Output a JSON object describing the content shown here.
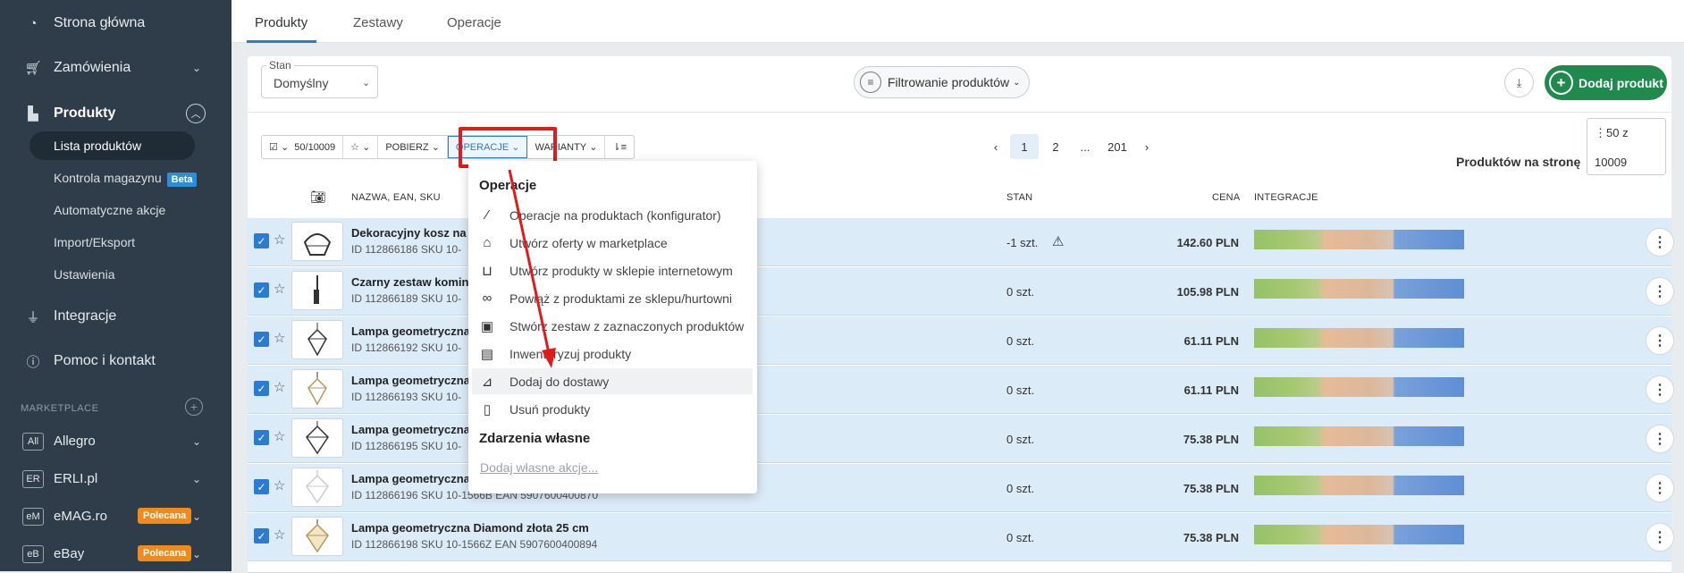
{
  "sidebar": {
    "items": [
      {
        "label": "Strona główna",
        "icon": "dashboard-icon"
      },
      {
        "label": "Zamówienia",
        "icon": "cart-icon"
      },
      {
        "label": "Produkty",
        "icon": "factory-icon"
      },
      {
        "label": "Integracje",
        "icon": "plug-icon"
      },
      {
        "label": "Pomoc i kontakt",
        "icon": "help-icon"
      }
    ],
    "sub_items": [
      "Lista produktów",
      "Kontrola magazynu",
      "Automatyczne akcje",
      "Import/Eksport",
      "Ustawienia"
    ],
    "beta_badge": "Beta",
    "marketplace_header": "MARKETPLACE",
    "marketplaces": [
      {
        "abbr": "All",
        "label": "Allegro"
      },
      {
        "abbr": "ER",
        "label": "ERLI.pl"
      },
      {
        "abbr": "eM",
        "label": "eMAG.ro",
        "badge": "Polecana"
      },
      {
        "abbr": "eB",
        "label": "eBay",
        "badge": "Polecana"
      }
    ]
  },
  "tabs": [
    "Produkty",
    "Zestawy",
    "Operacje"
  ],
  "filters": {
    "stan_label": "Stan",
    "stan_value": "Domyślny",
    "filter_button": "Filtrowanie produktów",
    "add_product": "Dodaj produkt"
  },
  "toolbar": {
    "selection": "50/10009",
    "pobierz": "POBIERZ",
    "operacje": "OPERACJE",
    "warianty": "WARIANTY"
  },
  "pagination": {
    "pages": [
      "1",
      "2",
      "...",
      "201"
    ],
    "current": "1"
  },
  "per_page": {
    "label": "Produktów na stronę",
    "value": "50 z",
    "total": "10009"
  },
  "table": {
    "headers": [
      "NAZWA, EAN, SKU",
      "STAN",
      "CENA",
      "INTEGRACJE"
    ],
    "rows": [
      {
        "name": "Dekoracyjny kosz na d",
        "meta": "ID 112866186 SKU 10-",
        "stan": "-1 szt.",
        "price": "142.60 PLN",
        "warning": true
      },
      {
        "name": "Czarny zestaw komin",
        "meta": "ID 112866189 SKU 10-",
        "stan": "0 szt.",
        "price": "105.98 PLN"
      },
      {
        "name": "Lampa geometryczna",
        "meta": "ID 112866192 SKU 10-",
        "stan": "0 szt.",
        "price": "61.11 PLN"
      },
      {
        "name": "Lampa geometryczna",
        "meta": "ID 112866193 SKU 10-",
        "stan": "0 szt.",
        "price": "61.11 PLN"
      },
      {
        "name": "Lampa geometryczna",
        "meta": "ID 112866195 SKU 10-",
        "stan": "0 szt.",
        "price": "75.38 PLN"
      },
      {
        "name": "Lampa geometryczna",
        "meta": "ID 112866196 SKU 10-1566B EAN 5907600400870",
        "stan": "0 szt.",
        "price": "75.38 PLN"
      },
      {
        "name": "Lampa geometryczna Diamond złota 25 cm",
        "meta": "ID 112866198 SKU 10-1566Z EAN 5907600400894",
        "stan": "0 szt.",
        "price": "75.38 PLN"
      }
    ]
  },
  "dropdown": {
    "header": "Operacje",
    "items": [
      {
        "label": "Operacje na produktach (konfigurator)",
        "icon": "magic-wand-icon"
      },
      {
        "label": "Utwórz oferty w marketplace",
        "icon": "bag-icon"
      },
      {
        "label": "Utwórz produkty w sklepie internetowym",
        "icon": "cart-icon"
      },
      {
        "label": "Powiąż z produktami ze sklepu/hurtowni",
        "icon": "link-icon"
      },
      {
        "label": "Stwórz zestaw z zaznaczonych produktów",
        "icon": "bundle-icon"
      },
      {
        "label": "Inwentaryzuj produkty",
        "icon": "clipboard-icon"
      },
      {
        "label": "Dodaj do dostawy",
        "icon": "hand-truck-icon"
      },
      {
        "label": "Usuń produkty",
        "icon": "trash-icon"
      }
    ],
    "custom_header": "Zdarzenia własne",
    "custom_link": "Dodaj własne akcje..."
  },
  "colors": {
    "accent": "#2b7bd0",
    "sidebar": "#2f3d4a",
    "add_button": "#1f8a4c",
    "highlight": "#e01b1b"
  }
}
